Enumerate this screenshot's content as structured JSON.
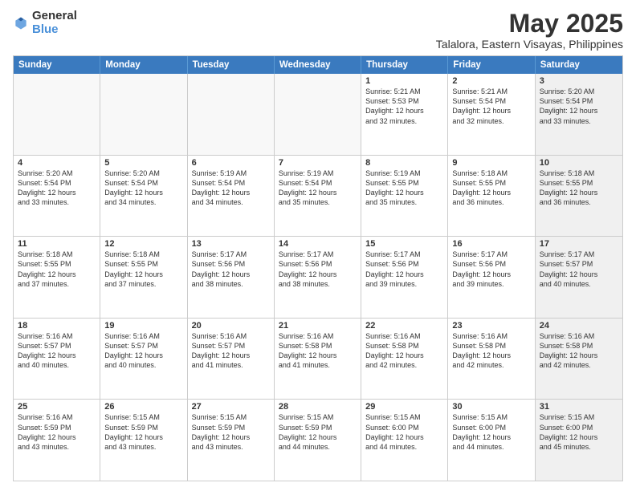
{
  "logo": {
    "general": "General",
    "blue": "Blue"
  },
  "header": {
    "title": "May 2025",
    "subtitle": "Talalora, Eastern Visayas, Philippines"
  },
  "weekdays": [
    "Sunday",
    "Monday",
    "Tuesday",
    "Wednesday",
    "Thursday",
    "Friday",
    "Saturday"
  ],
  "rows": [
    [
      {
        "day": "",
        "text": "",
        "empty": true
      },
      {
        "day": "",
        "text": "",
        "empty": true
      },
      {
        "day": "",
        "text": "",
        "empty": true
      },
      {
        "day": "",
        "text": "",
        "empty": true
      },
      {
        "day": "1",
        "text": "Sunrise: 5:21 AM\nSunset: 5:53 PM\nDaylight: 12 hours\nand 32 minutes.",
        "empty": false
      },
      {
        "day": "2",
        "text": "Sunrise: 5:21 AM\nSunset: 5:54 PM\nDaylight: 12 hours\nand 32 minutes.",
        "empty": false
      },
      {
        "day": "3",
        "text": "Sunrise: 5:20 AM\nSunset: 5:54 PM\nDaylight: 12 hours\nand 33 minutes.",
        "empty": false,
        "shaded": true
      }
    ],
    [
      {
        "day": "4",
        "text": "Sunrise: 5:20 AM\nSunset: 5:54 PM\nDaylight: 12 hours\nand 33 minutes.",
        "empty": false
      },
      {
        "day": "5",
        "text": "Sunrise: 5:20 AM\nSunset: 5:54 PM\nDaylight: 12 hours\nand 34 minutes.",
        "empty": false
      },
      {
        "day": "6",
        "text": "Sunrise: 5:19 AM\nSunset: 5:54 PM\nDaylight: 12 hours\nand 34 minutes.",
        "empty": false
      },
      {
        "day": "7",
        "text": "Sunrise: 5:19 AM\nSunset: 5:54 PM\nDaylight: 12 hours\nand 35 minutes.",
        "empty": false
      },
      {
        "day": "8",
        "text": "Sunrise: 5:19 AM\nSunset: 5:55 PM\nDaylight: 12 hours\nand 35 minutes.",
        "empty": false
      },
      {
        "day": "9",
        "text": "Sunrise: 5:18 AM\nSunset: 5:55 PM\nDaylight: 12 hours\nand 36 minutes.",
        "empty": false
      },
      {
        "day": "10",
        "text": "Sunrise: 5:18 AM\nSunset: 5:55 PM\nDaylight: 12 hours\nand 36 minutes.",
        "empty": false,
        "shaded": true
      }
    ],
    [
      {
        "day": "11",
        "text": "Sunrise: 5:18 AM\nSunset: 5:55 PM\nDaylight: 12 hours\nand 37 minutes.",
        "empty": false
      },
      {
        "day": "12",
        "text": "Sunrise: 5:18 AM\nSunset: 5:55 PM\nDaylight: 12 hours\nand 37 minutes.",
        "empty": false
      },
      {
        "day": "13",
        "text": "Sunrise: 5:17 AM\nSunset: 5:56 PM\nDaylight: 12 hours\nand 38 minutes.",
        "empty": false
      },
      {
        "day": "14",
        "text": "Sunrise: 5:17 AM\nSunset: 5:56 PM\nDaylight: 12 hours\nand 38 minutes.",
        "empty": false
      },
      {
        "day": "15",
        "text": "Sunrise: 5:17 AM\nSunset: 5:56 PM\nDaylight: 12 hours\nand 39 minutes.",
        "empty": false
      },
      {
        "day": "16",
        "text": "Sunrise: 5:17 AM\nSunset: 5:56 PM\nDaylight: 12 hours\nand 39 minutes.",
        "empty": false
      },
      {
        "day": "17",
        "text": "Sunrise: 5:17 AM\nSunset: 5:57 PM\nDaylight: 12 hours\nand 40 minutes.",
        "empty": false,
        "shaded": true
      }
    ],
    [
      {
        "day": "18",
        "text": "Sunrise: 5:16 AM\nSunset: 5:57 PM\nDaylight: 12 hours\nand 40 minutes.",
        "empty": false
      },
      {
        "day": "19",
        "text": "Sunrise: 5:16 AM\nSunset: 5:57 PM\nDaylight: 12 hours\nand 40 minutes.",
        "empty": false
      },
      {
        "day": "20",
        "text": "Sunrise: 5:16 AM\nSunset: 5:57 PM\nDaylight: 12 hours\nand 41 minutes.",
        "empty": false
      },
      {
        "day": "21",
        "text": "Sunrise: 5:16 AM\nSunset: 5:58 PM\nDaylight: 12 hours\nand 41 minutes.",
        "empty": false
      },
      {
        "day": "22",
        "text": "Sunrise: 5:16 AM\nSunset: 5:58 PM\nDaylight: 12 hours\nand 42 minutes.",
        "empty": false
      },
      {
        "day": "23",
        "text": "Sunrise: 5:16 AM\nSunset: 5:58 PM\nDaylight: 12 hours\nand 42 minutes.",
        "empty": false
      },
      {
        "day": "24",
        "text": "Sunrise: 5:16 AM\nSunset: 5:58 PM\nDaylight: 12 hours\nand 42 minutes.",
        "empty": false,
        "shaded": true
      }
    ],
    [
      {
        "day": "25",
        "text": "Sunrise: 5:16 AM\nSunset: 5:59 PM\nDaylight: 12 hours\nand 43 minutes.",
        "empty": false
      },
      {
        "day": "26",
        "text": "Sunrise: 5:15 AM\nSunset: 5:59 PM\nDaylight: 12 hours\nand 43 minutes.",
        "empty": false
      },
      {
        "day": "27",
        "text": "Sunrise: 5:15 AM\nSunset: 5:59 PM\nDaylight: 12 hours\nand 43 minutes.",
        "empty": false
      },
      {
        "day": "28",
        "text": "Sunrise: 5:15 AM\nSunset: 5:59 PM\nDaylight: 12 hours\nand 44 minutes.",
        "empty": false
      },
      {
        "day": "29",
        "text": "Sunrise: 5:15 AM\nSunset: 6:00 PM\nDaylight: 12 hours\nand 44 minutes.",
        "empty": false
      },
      {
        "day": "30",
        "text": "Sunrise: 5:15 AM\nSunset: 6:00 PM\nDaylight: 12 hours\nand 44 minutes.",
        "empty": false
      },
      {
        "day": "31",
        "text": "Sunrise: 5:15 AM\nSunset: 6:00 PM\nDaylight: 12 hours\nand 45 minutes.",
        "empty": false,
        "shaded": true
      }
    ]
  ]
}
